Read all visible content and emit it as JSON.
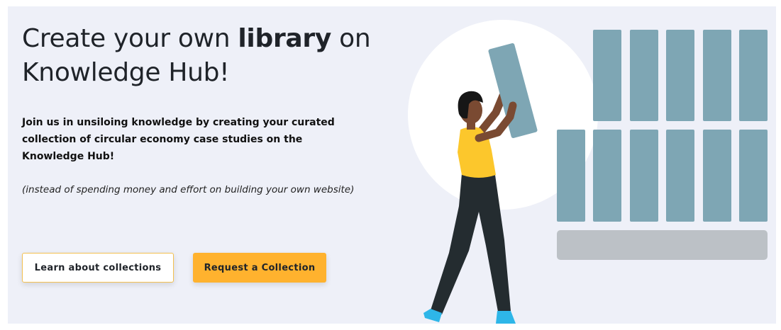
{
  "hero": {
    "title_pre": "Create your own ",
    "title_bold": "library",
    "title_post": " on Knowledge Hub!",
    "lead": "Join us in unsiloing knowledge by creating your curated collection of circular economy case studies on the Knowledge Hub!",
    "note": "(instead of spending money and effort on building your own website)"
  },
  "buttons": {
    "learn_label": "Learn about collections",
    "request_label": "Request a Collection"
  },
  "colors": {
    "background": "#eef0f8",
    "accent": "#ffb22e",
    "outline": "#f3c050",
    "shelf_book": "#7ea6b4",
    "shelf_base": "#bcc1c6",
    "shirt": "#fcc72c",
    "pants": "#242c30",
    "shoes": "#2eb6e8"
  },
  "illustration": {
    "subject": "person-placing-book-on-shelf"
  }
}
